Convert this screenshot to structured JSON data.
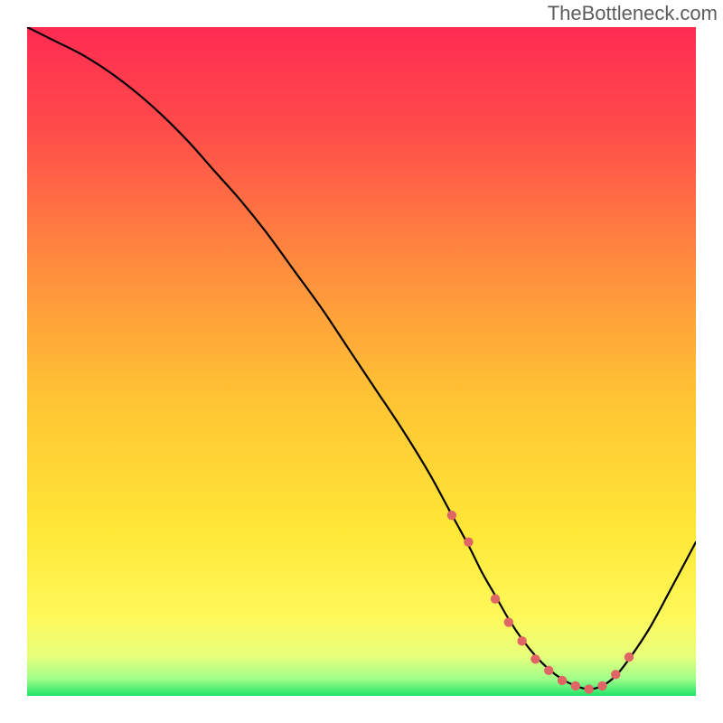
{
  "watermark": "TheBottleneck.com",
  "chart_data": {
    "type": "line",
    "title": "",
    "xlabel": "",
    "ylabel": "",
    "xlim": [
      0,
      100
    ],
    "ylim": [
      0,
      100
    ],
    "grid": false,
    "background_gradient": {
      "top_color": "#ff2b52",
      "mid_color": "#ffd630",
      "bottom_green_band": "#21e36b"
    },
    "series": [
      {
        "name": "bottleneck-curve",
        "color": "#000000",
        "x": [
          0,
          4,
          8,
          12,
          16,
          20,
          24,
          28,
          32,
          36,
          40,
          44,
          48,
          52,
          56,
          60,
          63,
          66,
          68,
          70,
          72,
          74,
          76,
          78,
          80,
          82,
          84,
          86,
          88,
          90,
          93,
          96,
          100
        ],
        "y": [
          100,
          98,
          96,
          93.5,
          90.5,
          87,
          83,
          78.5,
          74,
          69,
          63.5,
          58,
          52,
          46,
          40,
          33.5,
          28,
          22.5,
          18.5,
          15,
          11.5,
          8.5,
          6,
          4,
          2.5,
          1.5,
          1,
          1.5,
          3,
          5.5,
          10,
          15.5,
          23
        ]
      },
      {
        "name": "curve-markers",
        "type": "scatter",
        "color": "#e06666",
        "x": [
          63.5,
          66,
          70,
          72,
          74,
          76,
          78,
          80,
          82,
          84,
          86,
          88,
          90
        ],
        "y": [
          27,
          23,
          14.5,
          11,
          8.2,
          5.5,
          3.8,
          2.3,
          1.5,
          1,
          1.5,
          3.2,
          5.8
        ]
      }
    ]
  }
}
